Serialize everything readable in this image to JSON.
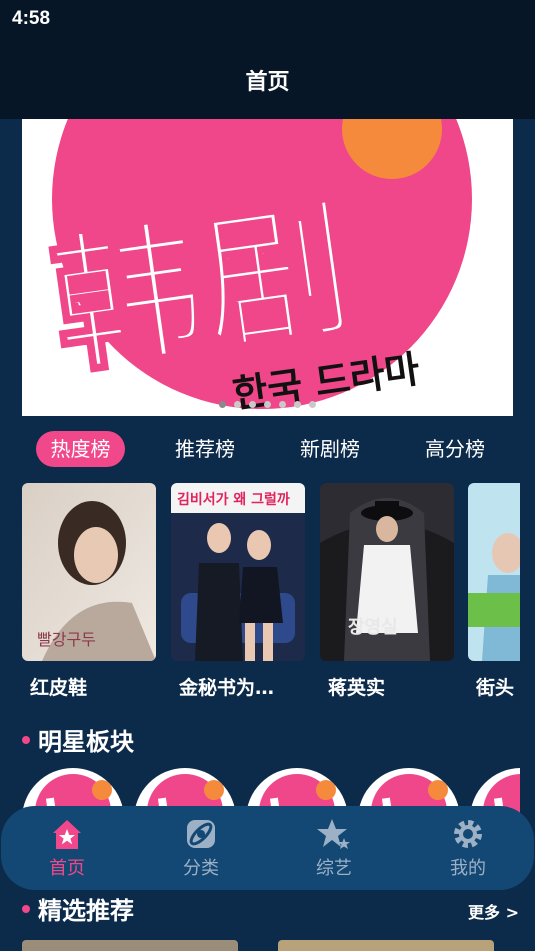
{
  "status_bar": {
    "time": "4:58"
  },
  "header": {
    "title": "首页"
  },
  "banner": {
    "title_chars": "韩剧",
    "subtitle": "한국 드라마",
    "slide_count": 7,
    "active_slide": 1,
    "colors": {
      "pink": "#f0478a",
      "orange": "#f68a3c"
    }
  },
  "rank_tabs": [
    {
      "label": "热度榜",
      "active": true
    },
    {
      "label": "推荐榜",
      "active": false
    },
    {
      "label": "新剧榜",
      "active": false
    },
    {
      "label": "高分榜",
      "active": false
    }
  ],
  "dramas": [
    {
      "title": "红皮鞋",
      "poster_text": "빨강구두"
    },
    {
      "title": "金秘书为…",
      "poster_text": "김비서가 왜 그럴까"
    },
    {
      "title": "蒋英实",
      "poster_text": "장영실"
    },
    {
      "title": "街头"
    }
  ],
  "stars_section": {
    "title": "明星板块"
  },
  "picks_section": {
    "title": "精选推荐",
    "more": "更多 >"
  },
  "bottom_nav": [
    {
      "label": "首页",
      "icon": "home-icon",
      "active": true
    },
    {
      "label": "分类",
      "icon": "category-icon",
      "active": false
    },
    {
      "label": "综艺",
      "icon": "star-icon",
      "active": false
    },
    {
      "label": "我的",
      "icon": "gear-icon",
      "active": false
    }
  ],
  "colors": {
    "background": "#0c2a4a",
    "header": "#061627",
    "accent": "#f0488a",
    "nav_bar": "#124873",
    "nav_inactive": "#9cb0c6"
  }
}
